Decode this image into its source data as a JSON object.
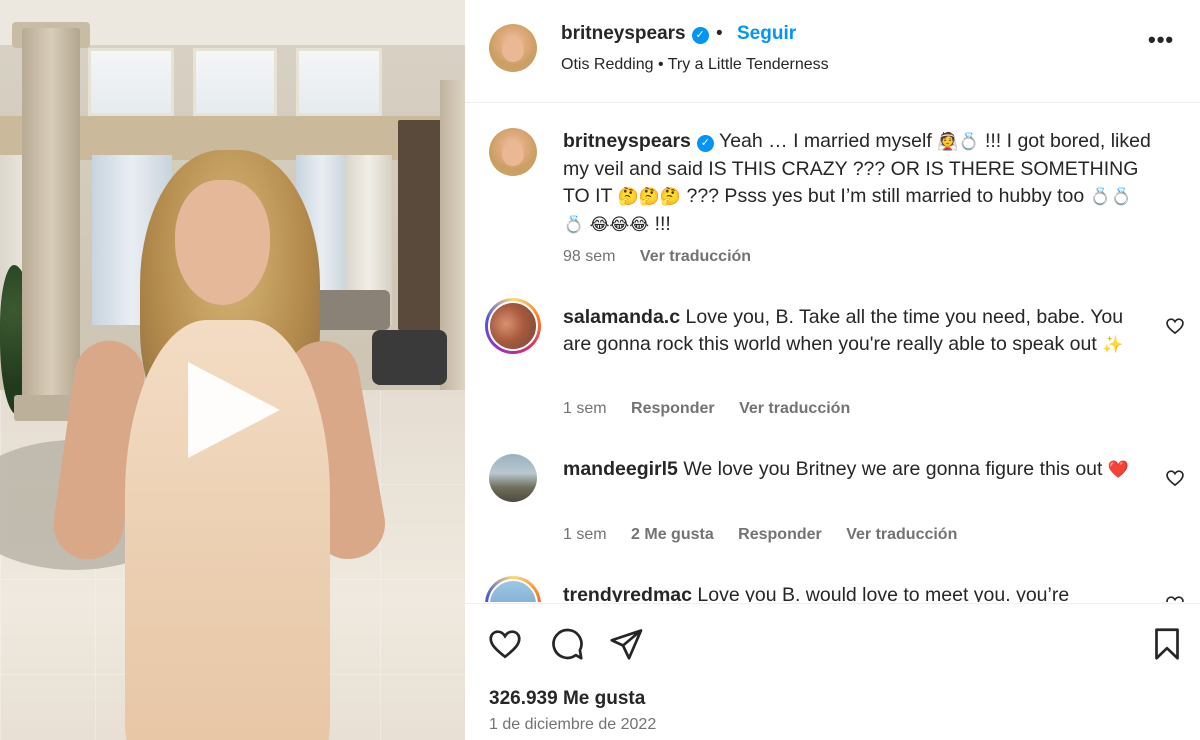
{
  "post": {
    "username": "britneyspears",
    "follow_label": "Seguir",
    "separator": "•",
    "audio": "Otis Redding • Try a Little Tenderness",
    "more_icon": "more-horizontal-icon",
    "likes": "326.939 Me gusta",
    "date": "1 de diciembre de 2022"
  },
  "caption": {
    "username": "britneyspears",
    "text_1": "Yeah … I married myself",
    "emoji_1": "👰💍",
    "text_2": "!!! I got bored, liked my veil and said IS THIS CRAZY ??? OR IS THERE SOMETHING TO IT",
    "emoji_2": "🤔🤔🤔",
    "text_3": "??? Psss yes but I’m still married to hubby too",
    "emoji_3": "💍💍💍 😂😂😂",
    "text_4": "!!!",
    "time": "98 sem",
    "translate": "Ver traducción"
  },
  "comments": [
    {
      "username": "salamanda.c",
      "text": "Love you, B. Take all the time you need, babe. You are gonna rock this world when you're really able to speak out",
      "emoji": "✨",
      "time": "1 sem",
      "reply": "Responder",
      "translate": "Ver traducción"
    },
    {
      "username": "mandeegirl5",
      "text": "We love you Britney we are gonna figure this out",
      "emoji": "❤️",
      "time": "1 sem",
      "likes": "2 Me gusta",
      "reply": "Responder",
      "translate": "Ver traducción"
    },
    {
      "username": "trendyredmac",
      "text": "Love you B. would love to meet you. you’re"
    }
  ],
  "icons": {
    "like": "heart-icon",
    "comment": "comment-icon",
    "share": "send-icon",
    "save": "bookmark-icon",
    "play": "play-icon",
    "verified": "verified-badge-icon"
  },
  "colors": {
    "accent": "#0095f6",
    "text": "#262626",
    "muted": "#737373",
    "divider": "#efefef"
  }
}
